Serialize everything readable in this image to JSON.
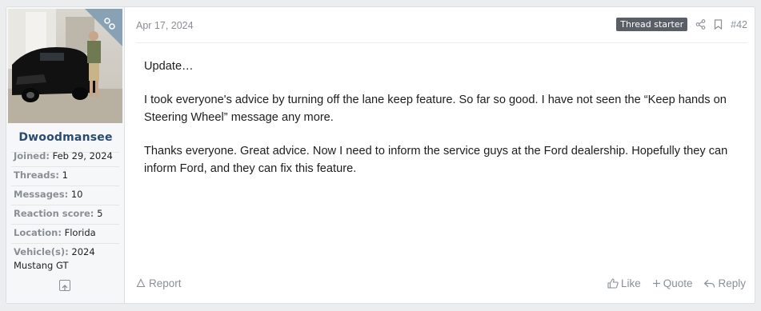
{
  "user": {
    "username": "Dwoodmansee",
    "stats": [
      {
        "key": "Joined:",
        "value": "Feb 29, 2024"
      },
      {
        "key": "Threads:",
        "value": "1"
      },
      {
        "key": "Messages:",
        "value": "10"
      },
      {
        "key": "Reaction score:",
        "value": "5"
      },
      {
        "key": "Location:",
        "value": "Florida"
      },
      {
        "key": "Vehicle(s):",
        "value": "2024 Mustang GT"
      }
    ]
  },
  "post": {
    "date": "Apr 17, 2024",
    "badge": "Thread starter",
    "number": "#42",
    "paragraphs": [
      "Update…",
      "I took everyone's advice by turning off the lane keep feature. So far so good. I have not seen the “Keep hands on Steering Wheel” message any more.",
      "Thanks everyone. Great advice. Now I need to inform the service guys at the Ford dealership. Hopefully they can inform Ford, and they can fix this feature."
    ]
  },
  "actions": {
    "report": "Report",
    "like": "Like",
    "quote": "Quote",
    "reply": "Reply"
  },
  "icons": {
    "share": "share-icon",
    "bookmark": "bookmark-icon",
    "flag": "report-icon",
    "thumb": "like-icon",
    "plus": "quote-icon",
    "reply": "reply-icon",
    "up": "scroll-up-icon",
    "ribbon": "ribbon-icon"
  }
}
